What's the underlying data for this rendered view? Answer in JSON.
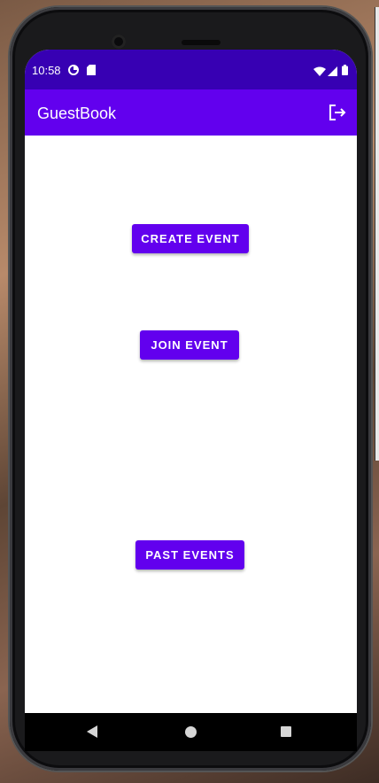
{
  "status_bar": {
    "time": "10:58",
    "icons": [
      "data-saver-icon",
      "sd-card-icon",
      "wifi-icon",
      "signal-icon",
      "battery-icon"
    ]
  },
  "app_bar": {
    "title": "GuestBook",
    "action_icon": "logout-icon"
  },
  "main": {
    "create_event_label": "CREATE EVENT",
    "join_event_label": "JOIN EVENT",
    "past_events_label": "PAST EVENTS"
  },
  "nav_bar": {
    "icons": [
      "back-icon",
      "home-icon",
      "recents-icon"
    ]
  },
  "colors": {
    "status_bar": "#3700b3",
    "primary": "#6200ee",
    "background": "#ffffff"
  }
}
